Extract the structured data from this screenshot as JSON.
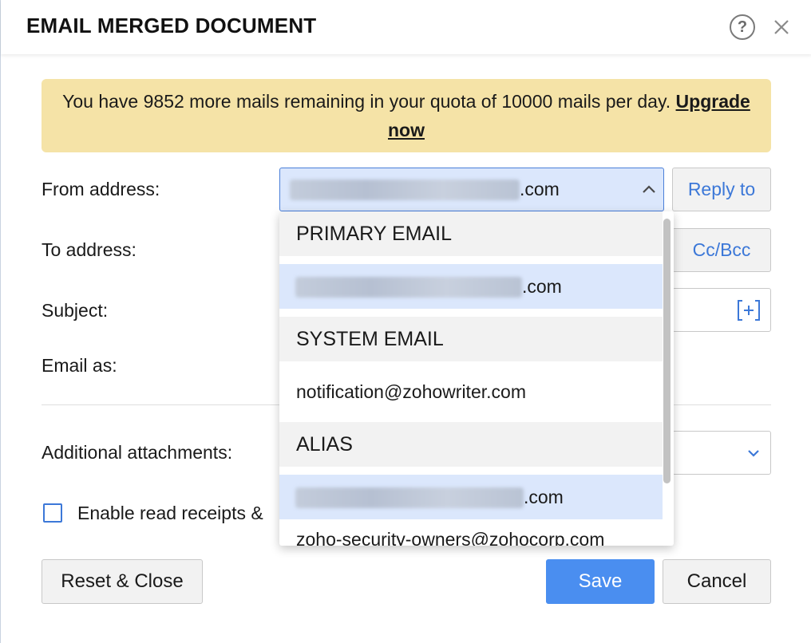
{
  "dialog": {
    "title": "EMAIL MERGED DOCUMENT",
    "help_icon": "question-circle-icon",
    "close_icon": "close-icon"
  },
  "banner": {
    "text_prefix": "You have 9852 more mails remaining in your quota of 10000 mails per day.",
    "upgrade_link": "Upgrade now",
    "color": "#f5e3a7"
  },
  "form": {
    "from_label": "From address:",
    "from_value_suffix": ".com",
    "reply_to_button": "Reply to",
    "to_label": "To address:",
    "cc_bcc_button": "Cc/Bcc",
    "subject_label": "Subject:",
    "insert_field_icon": "insert-field-icon",
    "email_as_label": "Email as:",
    "attachments_label": "Additional attachments:",
    "read_receipts_label": "Enable read receipts & "
  },
  "dropdown": {
    "groups": [
      {
        "header": "PRIMARY EMAIL",
        "item": ".com",
        "item_blurred": true,
        "selected": true
      },
      {
        "header": "SYSTEM EMAIL",
        "item": "notification@zohowriter.com",
        "item_blurred": false,
        "selected": false
      },
      {
        "header": "ALIAS",
        "item": ".com",
        "item_blurred": true,
        "selected": true
      }
    ],
    "partial_item": "zoho-security-owners@zohocorp.com"
  },
  "footer": {
    "reset_button": "Reset & Close",
    "save_button": "Save",
    "cancel_button": "Cancel"
  },
  "colors": {
    "accent": "#3c78d8",
    "primary_button": "#4a8ef0",
    "selected_bg": "#dbe7fc"
  }
}
